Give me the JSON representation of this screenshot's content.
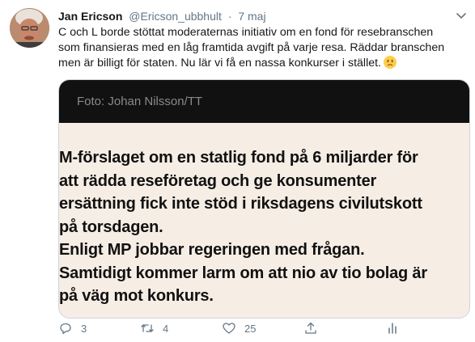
{
  "tweet": {
    "author_name": "Jan Ericson",
    "author_handle": "@Ericson_ubbhult",
    "separator": "·",
    "date": "7 maj",
    "text_lines": [
      "C och L borde stöttat moderaternas initiativ om en fond för resebranschen",
      "som finansieras med en låg framtida avgift på varje resa. Räddar branschen",
      "men är billigt för staten. Nu lär vi få en nassa konkurser i stället."
    ],
    "emoji_icon": "disappointed-face-icon"
  },
  "media": {
    "credit": "Foto: Johan Nilsson/TT",
    "headline_lines": [
      "M-förslaget om en statlig fond på 6 miljarder för",
      "att rädda reseföretag och ge konsumenter",
      "ersättning fick inte stöd i riksdagens civilutskott",
      "på torsdagen.",
      "Enligt MP jobbar regeringen med frågan.",
      "Samtidigt kommer larm om att nio av tio bolag är",
      "på väg mot konkurs."
    ]
  },
  "actions": {
    "reply_count": "3",
    "retweet_count": "4",
    "like_count": "25",
    "icons": [
      "reply-icon",
      "retweet-icon",
      "like-icon",
      "share-icon",
      "analytics-icon"
    ]
  },
  "colors": {
    "text": "#14171a",
    "muted": "#657786",
    "border": "#ccd6dd",
    "media_bg": "#f6ede5",
    "media_bar": "#111111"
  }
}
